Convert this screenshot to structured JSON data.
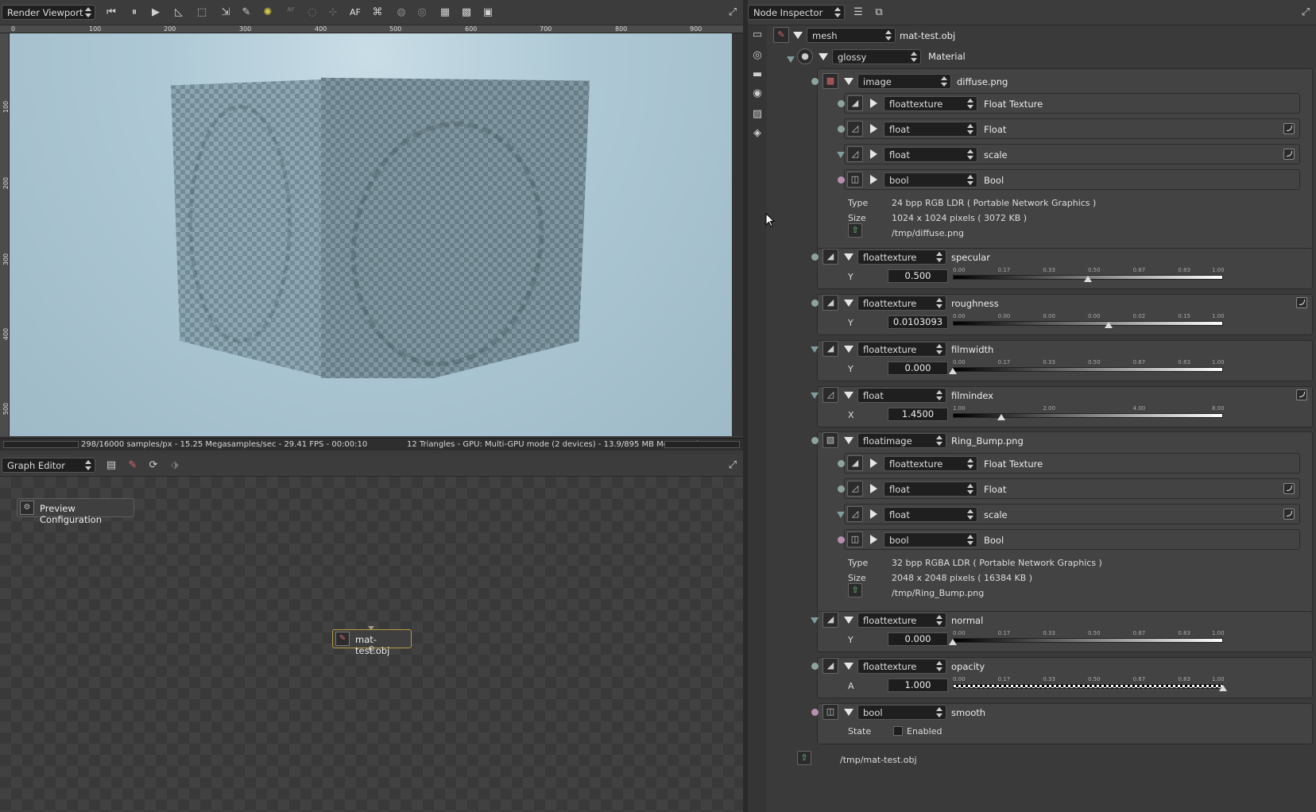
{
  "viewport": {
    "title": "Render Viewport",
    "af_label": "AF",
    "ruler_top": [
      "0",
      "100",
      "200",
      "300",
      "400",
      "500",
      "600",
      "700",
      "800",
      "900"
    ],
    "ruler_left": [
      "100",
      "200",
      "300",
      "400",
      "500"
    ],
    "status_left": "298/16000 samples/px - 15.25 Megasamples/sec - 29.41 FPS - 00:00:10",
    "status_right": "12 Triangles - GPU: Multi-GPU mode (2 devices) - 13.9/895 MB Mem Used"
  },
  "graph_editor": {
    "title": "Graph Editor",
    "preview_label": "Preview Configuration",
    "node_label": "mat-test.obj"
  },
  "inspector": {
    "title": "Node Inspector",
    "root": {
      "type": "mesh",
      "name": "mat-test.obj"
    },
    "material": {
      "type": "glossy",
      "name": "Material"
    },
    "diffuse": {
      "type": "image",
      "name": "diffuse.png",
      "children": [
        {
          "type": "floattexture",
          "name": "Float Texture"
        },
        {
          "type": "float",
          "name": "Float"
        },
        {
          "type": "float",
          "name": "scale"
        },
        {
          "type": "bool",
          "name": "Bool"
        }
      ],
      "type_label": "Type",
      "type_value": "24 bpp RGB LDR ( Portable Network Graphics )",
      "size_label": "Size",
      "size_value": "1024 x 1024 pixels ( 3072 KB )",
      "path": "/tmp/diffuse.png"
    },
    "specular": {
      "type": "floattexture",
      "name": "specular",
      "channel": "Y",
      "value": "0.500",
      "level": 0.5,
      "ticks": [
        "0.00",
        "0.17",
        "0.33",
        "0.50",
        "0.67",
        "0.83",
        "1.00"
      ]
    },
    "roughness": {
      "type": "floattexture",
      "name": "roughness",
      "channel": "Y",
      "value": "0.0103093",
      "level": 0.0103093,
      "ticks": [
        "0.00",
        "0.00",
        "0.00",
        "0.00",
        "0.02",
        "0.15",
        "1.00"
      ]
    },
    "filmwidth": {
      "type": "floattexture",
      "name": "filmwidth",
      "channel": "Y",
      "value": "0.000",
      "level": 0.0,
      "ticks": [
        "0.00",
        "0.17",
        "0.33",
        "0.50",
        "0.67",
        "0.83",
        "1.00"
      ]
    },
    "filmindex": {
      "type": "float",
      "name": "filmindex",
      "channel": "X",
      "value": "1.4500",
      "level": 1.45,
      "ticks": [
        "1.00",
        "2.00",
        "4.00",
        "8.00"
      ]
    },
    "bump": {
      "type": "floatimage",
      "name": "Ring_Bump.png",
      "children": [
        {
          "type": "floattexture",
          "name": "Float Texture"
        },
        {
          "type": "float",
          "name": "Float"
        },
        {
          "type": "float",
          "name": "scale"
        },
        {
          "type": "bool",
          "name": "Bool"
        }
      ],
      "type_label": "Type",
      "type_value": "32 bpp RGBA LDR ( Portable Network Graphics )",
      "size_label": "Size",
      "size_value": "2048 x 2048 pixels ( 16384 KB )",
      "path": "/tmp/Ring_Bump.png"
    },
    "normal": {
      "type": "floattexture",
      "name": "normal",
      "channel": "Y",
      "value": "0.000",
      "level": 0.0,
      "ticks": [
        "0.00",
        "0.17",
        "0.33",
        "0.50",
        "0.67",
        "0.83",
        "1.00"
      ]
    },
    "opacity": {
      "type": "floattexture",
      "name": "opacity",
      "channel": "A",
      "value": "1.000",
      "level": 1.0,
      "ticks": [
        "0.00",
        "0.17",
        "0.33",
        "0.50",
        "0.67",
        "0.83",
        "1.00"
      ]
    },
    "smooth": {
      "type": "bool",
      "name": "smooth",
      "state_label": "State",
      "enabled_label": "Enabled",
      "enabled": false
    },
    "footer_path": "/tmp/mat-test.obj"
  },
  "colors": {
    "pin_green": "#8ca49d",
    "pin_pink": "#b88fae",
    "pin_blue": "#7f9c9f"
  },
  "icons": [
    "skip-back-icon",
    "pause-icon",
    "play-icon",
    "grid-icon",
    "maximize-icon",
    "save-icon",
    "mesh-icon",
    "material-icon",
    "image-texture-icon",
    "file-icon"
  ]
}
